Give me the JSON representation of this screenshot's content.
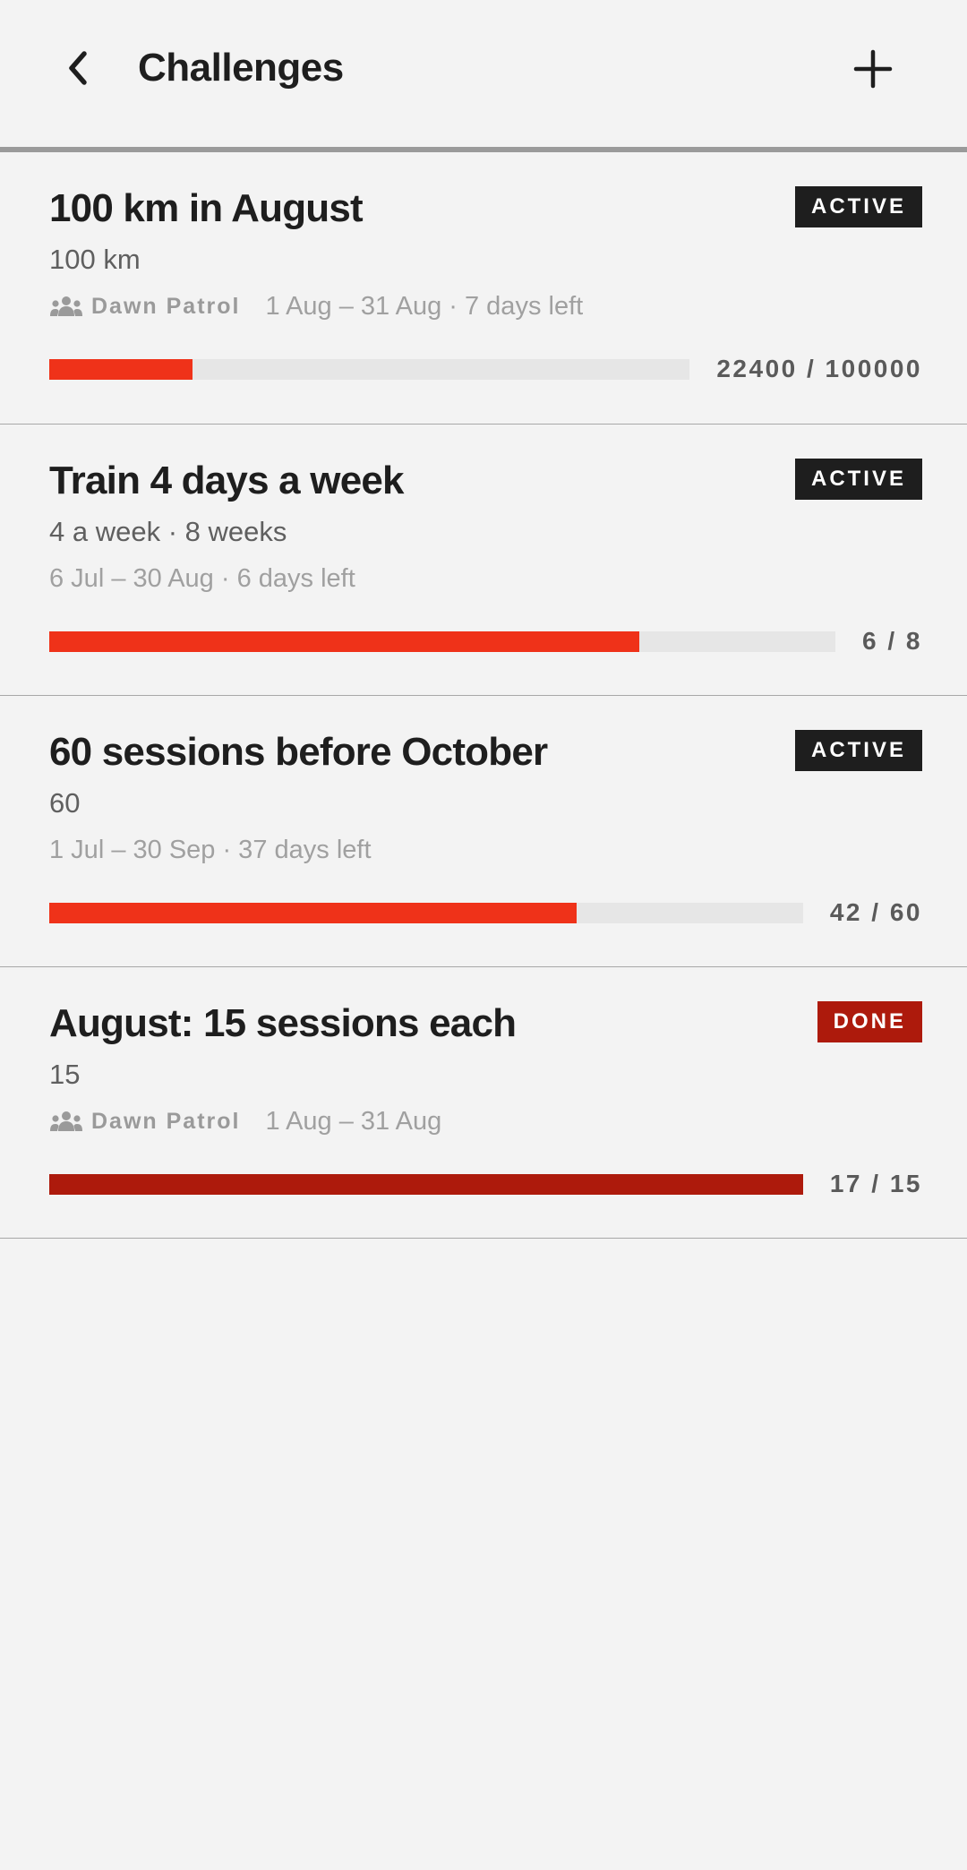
{
  "header": {
    "title": "Challenges",
    "back_icon": "chevron-left-icon",
    "add_icon": "plus-icon"
  },
  "colors": {
    "accent": "#ef3219",
    "done": "#ad1a0c",
    "badge_active": "#1e1e1e",
    "background": "#f3f3f3",
    "track": "#e6e6e6"
  },
  "challenges": [
    {
      "title": "100 km in August",
      "status": "ACTIVE",
      "target": "100 km",
      "group": "Dawn Patrol",
      "dates": "1 Aug – 31 Aug · 7 days left",
      "progress": 0.224,
      "count": "22400 / 100000"
    },
    {
      "title": "Train 4 days a week",
      "status": "ACTIVE",
      "target": "4 a week · 8 weeks",
      "group": "",
      "dates": "6 Jul – 30 Aug · 6 days left",
      "progress": 0.75,
      "count": "6 / 8"
    },
    {
      "title": "60 sessions before October",
      "status": "ACTIVE",
      "target": "60",
      "group": "",
      "dates": "1 Jul – 30 Sep · 37 days left",
      "progress": 0.7,
      "count": "42 / 60"
    },
    {
      "title": "August: 15 sessions each",
      "status": "DONE",
      "target": "15",
      "group": "Dawn Patrol",
      "dates": "1 Aug – 31 Aug",
      "progress": 1.0,
      "count": "17 / 15"
    }
  ]
}
